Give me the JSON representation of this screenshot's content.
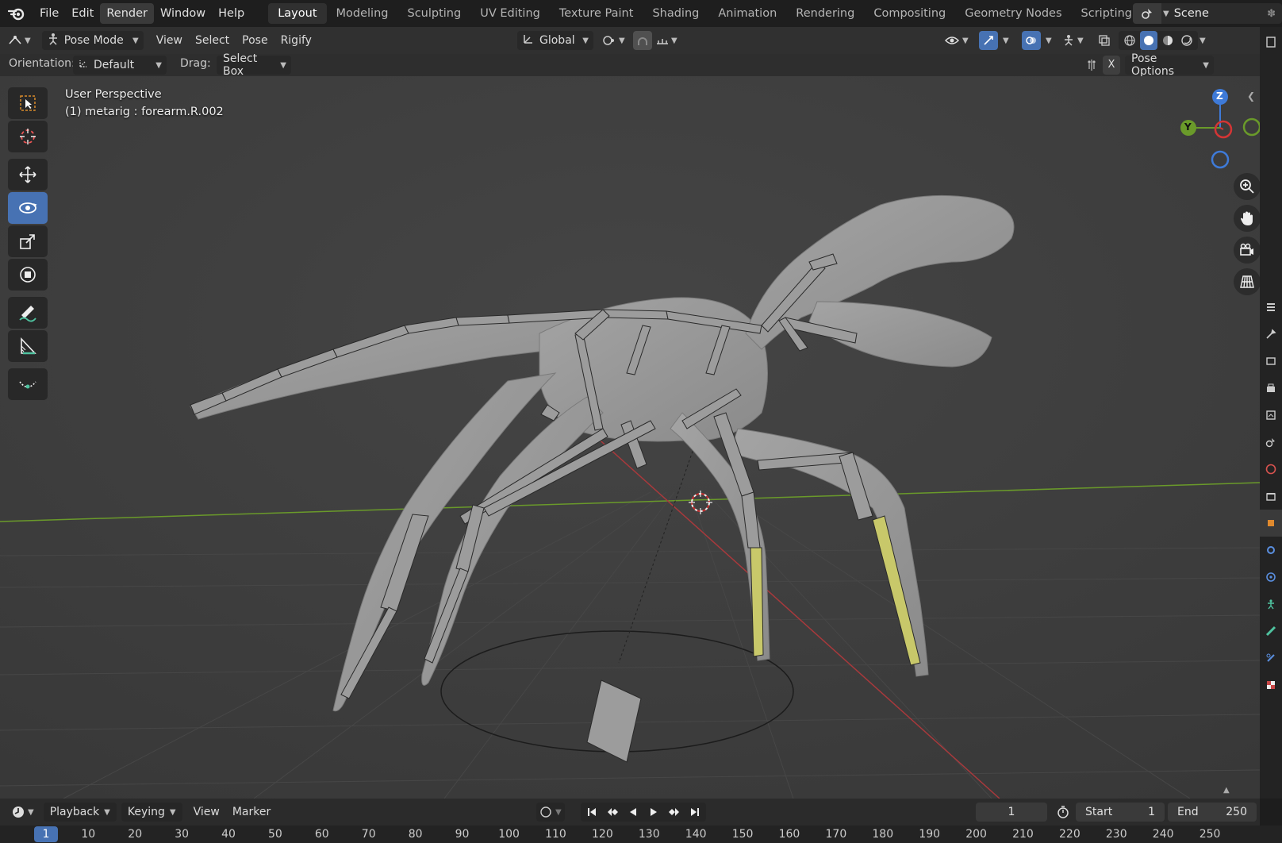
{
  "topbar": {
    "menus": [
      "File",
      "Edit",
      "Render",
      "Window",
      "Help"
    ],
    "active_menu": "Render",
    "workspaces": [
      "Layout",
      "Modeling",
      "Sculpting",
      "UV Editing",
      "Texture Paint",
      "Shading",
      "Animation",
      "Rendering",
      "Compositing",
      "Geometry Nodes",
      "Scripting"
    ],
    "active_workspace": "Layout",
    "add_tab": "+",
    "scene_name": "Scene"
  },
  "header": {
    "mode": "Pose Mode",
    "menus": [
      "View",
      "Select",
      "Pose",
      "Rigify"
    ],
    "transform_orientation": "Global"
  },
  "tool_settings": {
    "orientation_label": "Orientation:",
    "orientation_value": "Default",
    "drag_label": "Drag:",
    "drag_value": "Select Box",
    "x_mirror": "X",
    "pose_options": "Pose Options"
  },
  "viewport": {
    "perspective_label": "User Perspective",
    "active_object_label": "(1) metarig : forearm.R.002",
    "gizmo": {
      "z": "Z",
      "y": "Y"
    }
  },
  "timeline": {
    "menus": [
      "Playback",
      "Keying",
      "View",
      "Marker"
    ],
    "current_frame": "1",
    "start_label": "Start",
    "start_value": "1",
    "end_label": "End",
    "end_value": "250",
    "ruler_current": "1",
    "ruler_ticks": [
      "10",
      "20",
      "30",
      "40",
      "50",
      "60",
      "70",
      "80",
      "90",
      "100",
      "110",
      "120",
      "130",
      "140",
      "150",
      "160",
      "170",
      "180",
      "190",
      "200",
      "210",
      "220",
      "230",
      "240",
      "250"
    ]
  },
  "colors": {
    "accent": "#4772b3",
    "viewport_bg": "#3d3d3d",
    "x_axis": "#a8393c",
    "y_axis": "#6a9a2a",
    "selected_bone": "#c8c86a"
  }
}
